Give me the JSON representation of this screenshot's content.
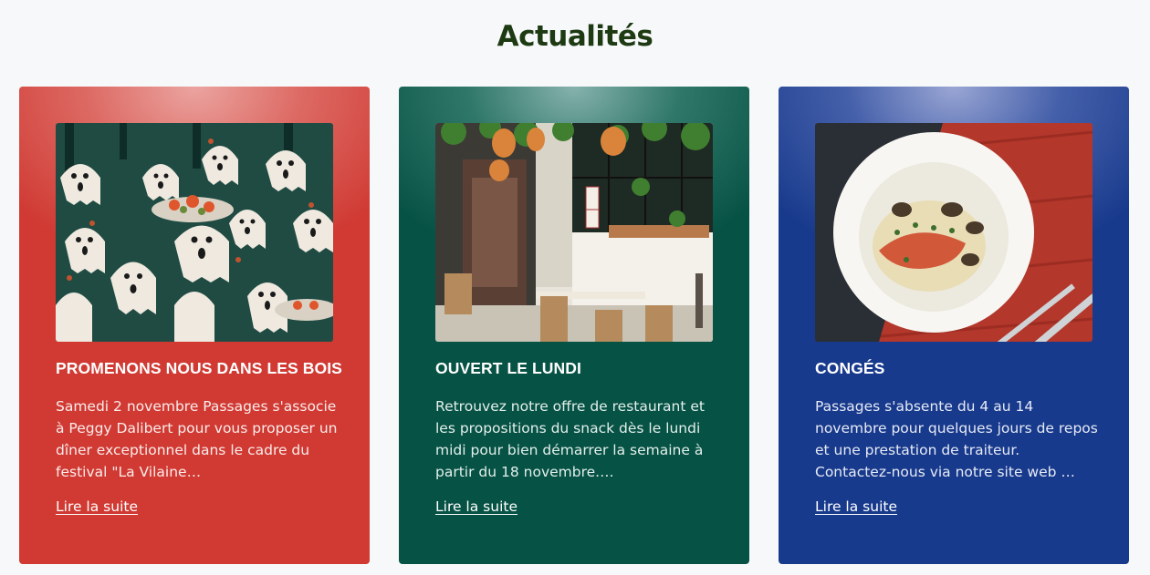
{
  "section": {
    "title": "Actualités"
  },
  "cards": [
    {
      "color": "#d03a33",
      "title": "PROMENONS NOUS DANS LES BOIS",
      "text": "Samedi 2 novembre Passages s'associe à Peggy Dalibert pour vous proposer un dîner exceptionnel dans le cadre du festival \"La Vilaine…",
      "link": "Lire la suite",
      "image": "ghosts-illustration"
    },
    {
      "color": "#065244",
      "title": "OUVERT LE LUNDI",
      "text": "Retrouvez notre offre de restaurant et les propositions du snack dès le lundi midi pour bien démarrer la semaine à partir du 18 novembre.…",
      "link": "Lire la suite",
      "image": "restaurant-interior-photo"
    },
    {
      "color": "#183a8c",
      "title": "CONGÉS",
      "text": "Passages s'absente du 4 au 14 novembre pour quelques jours de repos et une prestation de traiteur. Contactez-nous via notre site web …",
      "link": "Lire la suite",
      "image": "fish-dish-photo"
    }
  ]
}
